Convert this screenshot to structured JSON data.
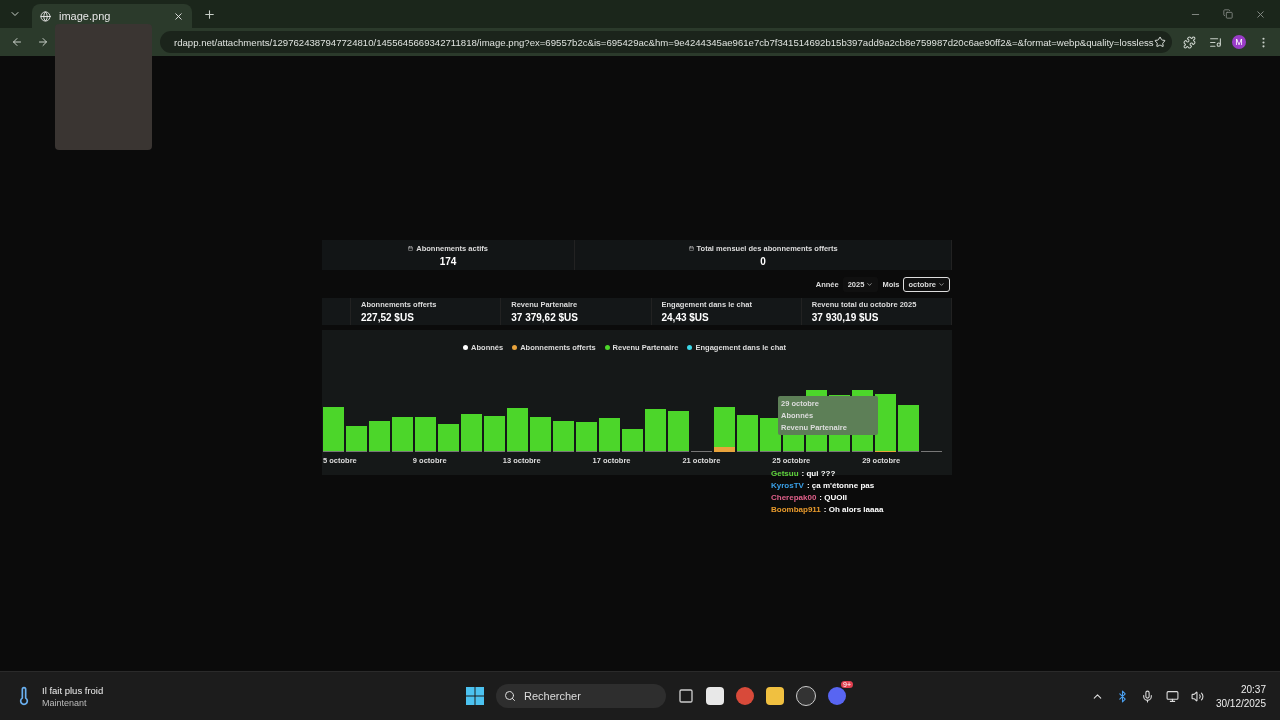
{
  "browser": {
    "tab": {
      "title": "image.png"
    },
    "url": "rdapp.net/attachments/1297624387947724810/1455645669342711818/image.png?ex=69557b2c&is=695429ac&hm=9e4244345ae961e7cb7f341514692b15b397add9a2cb8e759987d20c6ae90ff2&=&format=webp&quality=lossless",
    "profile": "M"
  },
  "dashboard": {
    "top_cards": [
      {
        "label": "Abonnements actifs",
        "value": "174"
      },
      {
        "label": "Total mensuel des abonnements offerts",
        "value": "0"
      }
    ],
    "filters": [
      {
        "label": "Année",
        "value": "2025",
        "focused": false
      },
      {
        "label": "Mois",
        "value": "octobre",
        "focused": true
      }
    ],
    "stats": [
      {
        "label": "Abonnements offerts",
        "value": "227,52 $US"
      },
      {
        "label": "Revenu Partenaire",
        "value": "37 379,62 $US"
      },
      {
        "label": "Engagement dans le chat",
        "value": "24,43 $US"
      },
      {
        "label": "Revenu total du octobre 2025",
        "value": "37 930,19 $US"
      }
    ],
    "chart": {
      "legend": [
        {
          "label": "Abonnés",
          "color": "#ffffff"
        },
        {
          "label": "Abonnements offerts",
          "color": "#e8a33c"
        },
        {
          "label": "Revenu Partenaire",
          "color": "#4cd62a"
        },
        {
          "label": "Engagement dans le chat",
          "color": "#3cd8e8"
        }
      ],
      "x_labels": [
        "5 octobre",
        "9 octobre",
        "13 octobre",
        "17 octobre",
        "21 octobre",
        "25 octobre",
        "29 octobre"
      ],
      "tooltip": {
        "title": "29 octobre",
        "rows": [
          "Abonnés",
          "Revenu Partenaire"
        ]
      }
    }
  },
  "chat": [
    {
      "user": "Getsuu",
      "message": ": qui ???",
      "color": "#5fd33c"
    },
    {
      "user": "KyrosTV",
      "message": ": ça m'étonne pas",
      "color": "#3aa0e8"
    },
    {
      "user": "Cherepak00",
      "message": ": QUOII",
      "color": "#e0608a"
    },
    {
      "user": "Boombap911",
      "message": ": Oh alors laaaa",
      "color": "#e89a2c"
    }
  ],
  "taskbar": {
    "weather": {
      "title": "Il fait plus froid",
      "subtitle": "Maintenant"
    },
    "search": {
      "placeholder": "Rechercher"
    },
    "discord_badge": "9+",
    "time": "20:37",
    "date": "30/12/2025"
  }
}
